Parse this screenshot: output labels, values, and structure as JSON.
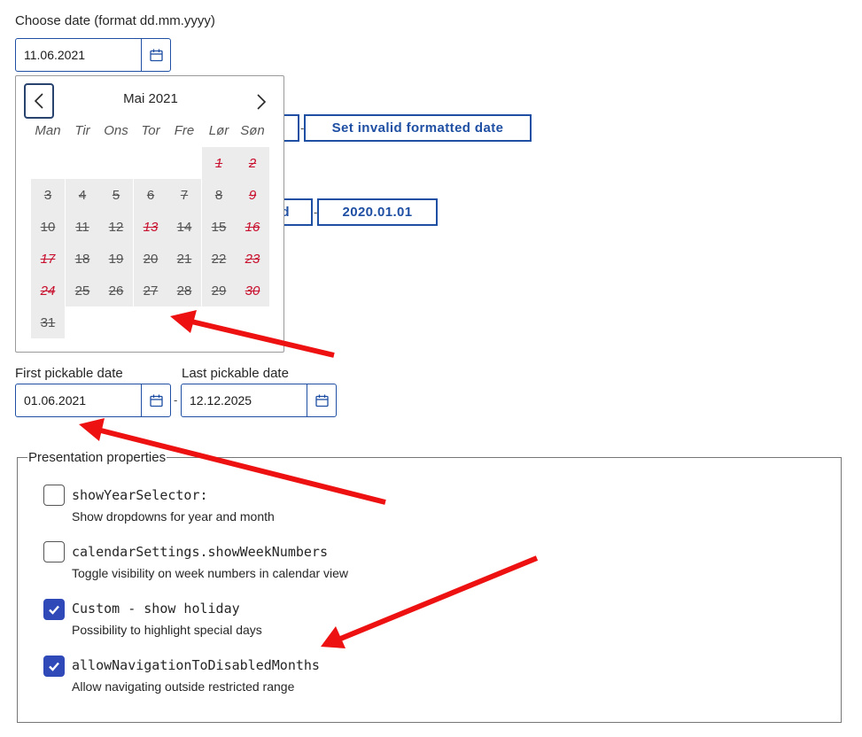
{
  "date_chooser": {
    "label": "Choose date (format dd.mm.yyyy)",
    "value": "11.06.2021",
    "calendar_icon": "calendar-icon"
  },
  "calendar": {
    "month_label": "Mai 2021",
    "prev_icon": "chevron-left-icon",
    "next_icon": "chevron-right-icon",
    "weekdays": [
      "Man",
      "Tir",
      "Ons",
      "Tor",
      "Fre",
      "Lør",
      "Søn"
    ],
    "weeks": [
      [
        null,
        null,
        null,
        null,
        null,
        {
          "d": "1",
          "hol": true
        },
        {
          "d": "2",
          "hol": true
        }
      ],
      [
        {
          "d": "3"
        },
        {
          "d": "4"
        },
        {
          "d": "5"
        },
        {
          "d": "6"
        },
        {
          "d": "7"
        },
        {
          "d": "8"
        },
        {
          "d": "9",
          "hol": true
        }
      ],
      [
        {
          "d": "10"
        },
        {
          "d": "11"
        },
        {
          "d": "12"
        },
        {
          "d": "13",
          "hol": true
        },
        {
          "d": "14"
        },
        {
          "d": "15"
        },
        {
          "d": "16",
          "hol": true
        }
      ],
      [
        {
          "d": "17",
          "hol": true
        },
        {
          "d": "18"
        },
        {
          "d": "19"
        },
        {
          "d": "20"
        },
        {
          "d": "21"
        },
        {
          "d": "22"
        },
        {
          "d": "23",
          "hol": true
        }
      ],
      [
        {
          "d": "24",
          "hol": true
        },
        {
          "d": "25"
        },
        {
          "d": "26"
        },
        {
          "d": "27"
        },
        {
          "d": "28"
        },
        {
          "d": "29"
        },
        {
          "d": "30",
          "hol": true
        }
      ],
      [
        {
          "d": "31"
        },
        null,
        null,
        null,
        null,
        null,
        null
      ]
    ]
  },
  "buttons": {
    "set_invalid_formatted": "Set invalid formatted date",
    "partial_label": "d",
    "date_2020": "2020.01.01",
    "dash": "-"
  },
  "range": {
    "first_label": "First pickable date",
    "first_value": "01.06.2021",
    "last_label": "Last pickable date",
    "last_value": "12.12.2025",
    "separator": "-"
  },
  "presentation": {
    "legend": "Presentation properties",
    "options": [
      {
        "name": "showYearSelector:",
        "desc": "Show dropdowns for year and month",
        "checked": false
      },
      {
        "name": "calendarSettings.showWeekNumbers",
        "desc": "Toggle visibility on week numbers in calendar view",
        "checked": false
      },
      {
        "name": "Custom - show holiday",
        "desc": "Possibility to highlight special days",
        "checked": true
      },
      {
        "name": "allowNavigationToDisabledMonths",
        "desc": "Allow navigating outside restricted range",
        "checked": true
      }
    ]
  },
  "colors": {
    "accent": "#1e4fa3",
    "holiday": "#c8102e",
    "checkbox_on": "#2f4ab8",
    "annotation_arrow": "#ee1111"
  }
}
